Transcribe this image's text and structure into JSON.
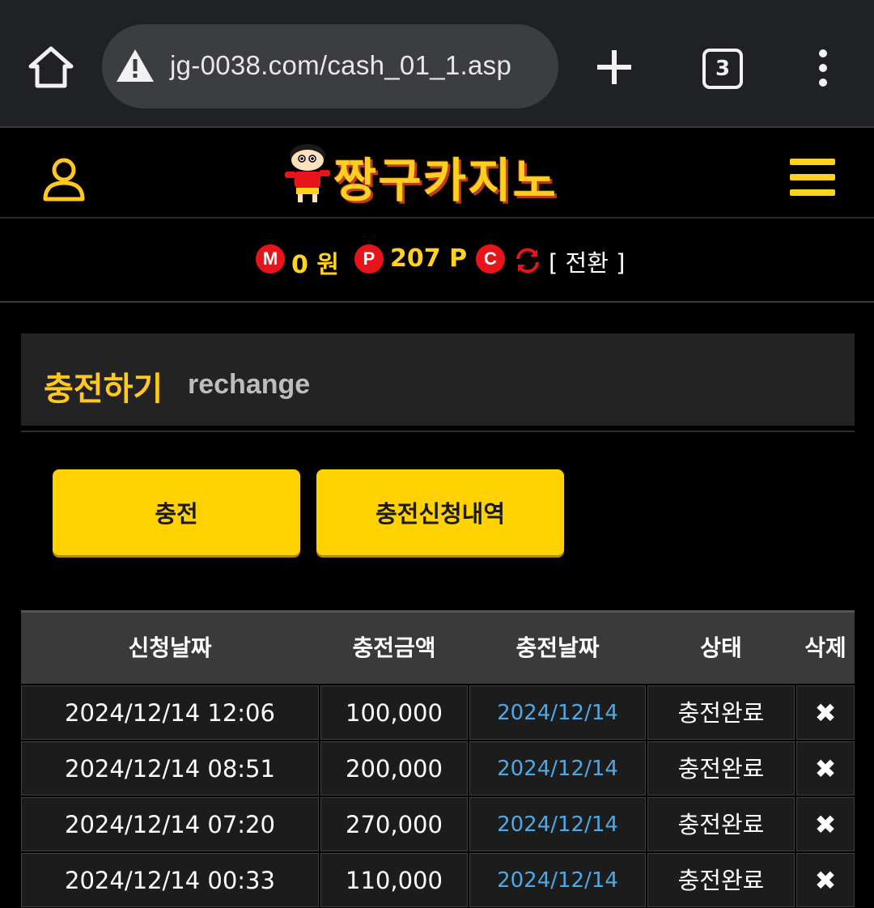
{
  "browser": {
    "url": "jg-0038.com/cash_01_1.asp",
    "tab_count": "3"
  },
  "site": {
    "logo_text": "짱구카지노"
  },
  "balance": {
    "money_badge": "M",
    "money_value": "0 원",
    "point_badge": "P",
    "point_value": "207 P",
    "coin_badge": "C",
    "convert_label": "[ 전환 ]"
  },
  "section": {
    "title_ko": "충전하기",
    "title_en": "rechange"
  },
  "buttons": {
    "charge": "충전",
    "history": "충전신청내역"
  },
  "table": {
    "headers": [
      "신청날짜",
      "충전금액",
      "충전날짜",
      "상태",
      "삭제"
    ],
    "rows": [
      {
        "request_date": "2024/12/14 12:06",
        "amount": "100,000",
        "charge_date": "2024/12/14",
        "status": "충전완료",
        "delete": "✖"
      },
      {
        "request_date": "2024/12/14 08:51",
        "amount": "200,000",
        "charge_date": "2024/12/14",
        "status": "충전완료",
        "delete": "✖"
      },
      {
        "request_date": "2024/12/14 07:20",
        "amount": "270,000",
        "charge_date": "2024/12/14",
        "status": "충전완료",
        "delete": "✖"
      },
      {
        "request_date": "2024/12/14 00:33",
        "amount": "110,000",
        "charge_date": "2024/12/14",
        "status": "충전완료",
        "delete": "✖"
      }
    ]
  },
  "colors": {
    "accent_yellow": "#ffd200",
    "badge_red": "#e8141b",
    "link_blue": "#4da8e8",
    "panel_dark": "#232323"
  }
}
